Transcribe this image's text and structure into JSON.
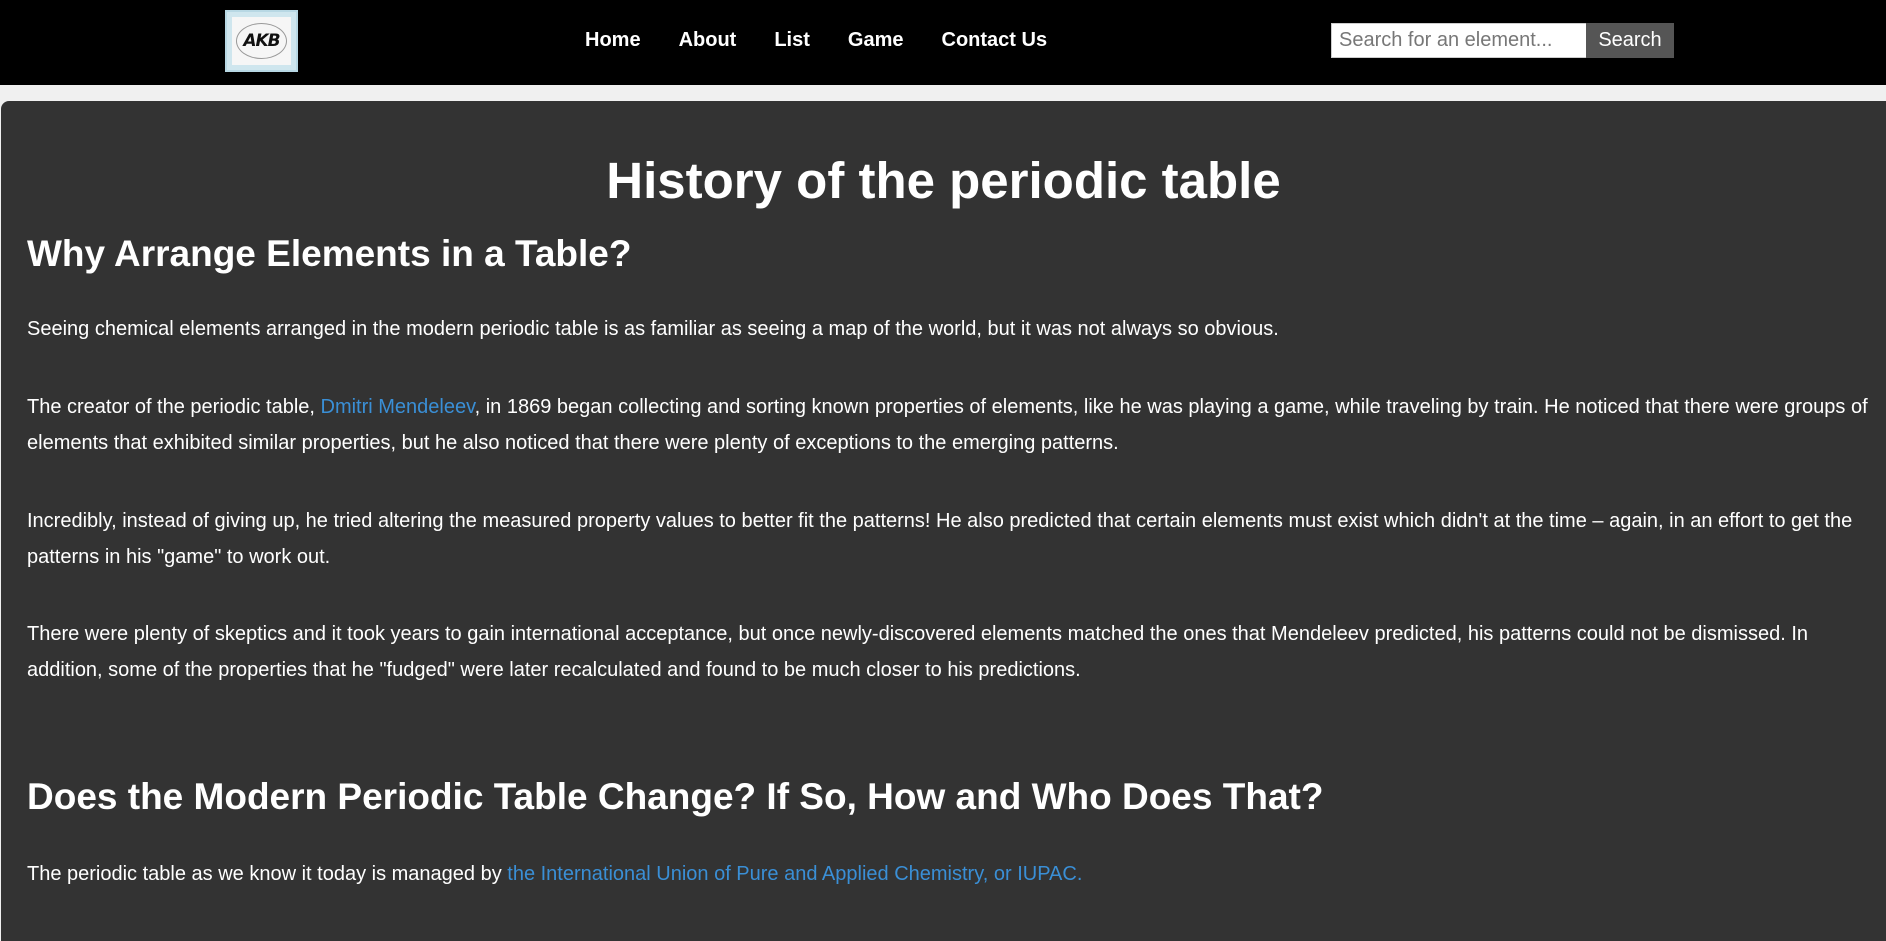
{
  "header": {
    "logo_text": "AKB",
    "nav": [
      "Home",
      "About",
      "List",
      "Game",
      "Contact Us"
    ],
    "search": {
      "placeholder": "Search for an element...",
      "value": "",
      "button_label": "Search"
    }
  },
  "main": {
    "title": "History of the periodic table",
    "sections": [
      {
        "heading": "Why Arrange Elements in a Table?",
        "p1": "Seeing chemical elements arranged in the modern periodic table is as familiar as seeing a map of the world, but it was not always so obvious.",
        "p2_before": "The creator of the periodic table, ",
        "p2_link": "Dmitri Mendeleev",
        "p2_after": ", in 1869 began collecting and sorting known properties of elements, like he was playing a game, while traveling by train. He noticed that there were groups of elements that exhibited similar properties, but he also noticed that there were plenty of exceptions to the emerging patterns.",
        "p3": "Incredibly, instead of giving up, he tried altering the measured property values to better fit the patterns! He also predicted that certain elements must exist which didn't at the time – again, in an effort to get the patterns in his \"game\" to work out.",
        "p4": "There were plenty of skeptics and it took years to gain international acceptance, but once newly-discovered elements matched the ones that Mendeleev predicted, his patterns could not be dismissed. In addition, some of the properties that he \"fudged\" were later recalculated and found to be much closer to his predictions."
      },
      {
        "heading": "Does the Modern Periodic Table Change? If So, How and Who Does That?",
        "p1_before": "The periodic table as we know it today is managed by ",
        "p1_link": "the International Union of Pure and Applied Chemistry, or IUPAC."
      }
    ]
  },
  "colors": {
    "navbar_bg": "#000000",
    "content_bg": "#333333",
    "link": "#3a8fd6",
    "search_button_bg": "#555555"
  }
}
